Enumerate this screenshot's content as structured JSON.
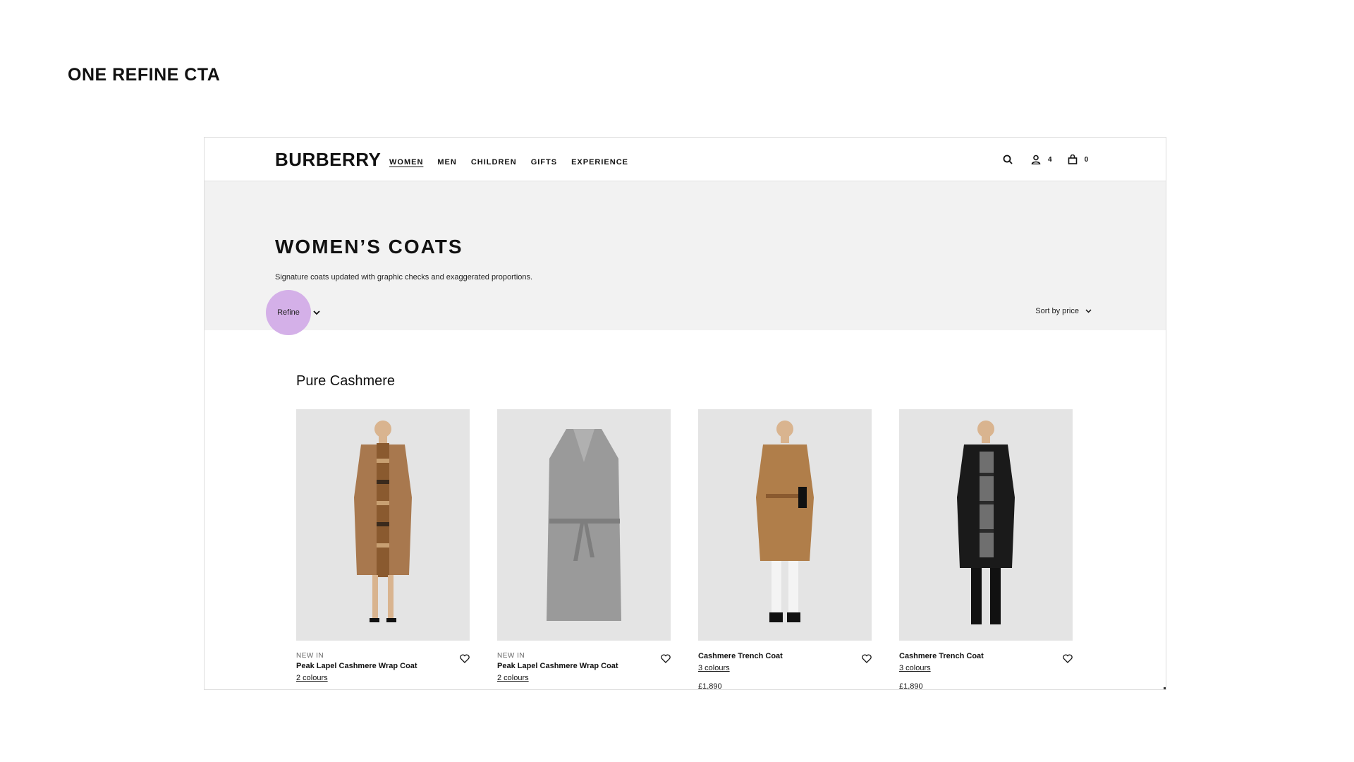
{
  "slide": {
    "title": "ONE REFINE CTA"
  },
  "header": {
    "logo": "BURBERRY",
    "nav": [
      "WOMEN",
      "MEN",
      "CHILDREN",
      "GIFTS",
      "EXPERIENCE"
    ],
    "account_count": "4",
    "bag_count": "0"
  },
  "hero": {
    "title": "WOMEN’S COATS",
    "description": "Signature coats updated with graphic checks and exaggerated proportions.",
    "refine_label": "Refine",
    "sort_label": "Sort by price"
  },
  "section": {
    "title": "Pure Cashmere"
  },
  "products": [
    {
      "badge": "NEW IN",
      "name": "Peak Lapel Cashmere Wrap Coat",
      "colours": "2 colours",
      "price": ""
    },
    {
      "badge": "NEW IN",
      "name": "Peak Lapel Cashmere Wrap Coat",
      "colours": "2 colours",
      "price": ""
    },
    {
      "badge": "",
      "name": "Cashmere Trench Coat",
      "colours": "3 colours",
      "price": "£1,890"
    },
    {
      "badge": "",
      "name": "Cashmere Trench Coat",
      "colours": "3 colours",
      "price": "£1,890"
    }
  ],
  "colors": {
    "refine_highlight": "#d4b0e8",
    "hero_bg": "#f2f2f2",
    "product_bg": "#e4e4e4",
    "camel": "#a8784e",
    "grey": "#9a9a9a",
    "black": "#1a1a1a"
  }
}
